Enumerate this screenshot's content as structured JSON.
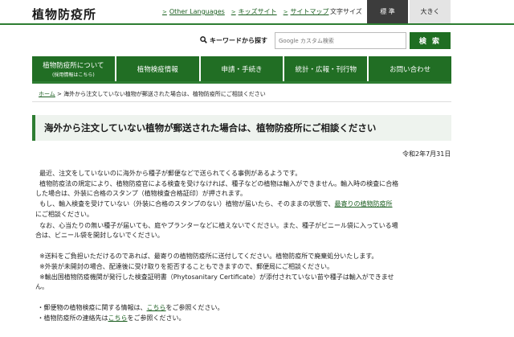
{
  "header": {
    "site_title": "植物防疫所",
    "links": [
      "Other Languages",
      "キッズサイト",
      "サイトマップ"
    ],
    "font_size_label": "文字サイズ",
    "font_standard": "標 準",
    "font_large": "大きく"
  },
  "search": {
    "label": "キーワードから探す",
    "placeholder": "Google カスタム検索",
    "button": "検 索"
  },
  "nav": {
    "items": [
      {
        "label": "植物防疫所について",
        "sub": "(採用情報はこちら)"
      },
      {
        "label": "植物検疫情報",
        "sub": ""
      },
      {
        "label": "申請・手続き",
        "sub": ""
      },
      {
        "label": "統計・広報・刊行物",
        "sub": ""
      },
      {
        "label": "お問い合わせ",
        "sub": ""
      }
    ]
  },
  "breadcrumb": {
    "home": "ホーム",
    "separator": ">",
    "current": "海外から注文していない植物が郵送された場合は、植物防疫所にご相談ください"
  },
  "main": {
    "title": "海外から注文していない植物が郵送された場合は、植物防疫所にご相談ください",
    "date": "令和2年7月31日",
    "p1": "最近、注文をしていないのに海外から種子が郵便などで送られてくる事例があるようです。",
    "p2a": "植物防疫法の規定により、植物防疫官による検査を受けなければ、種子などの植物は輸入ができません。輸入時の検査に合格",
    "p2b": "した場合は、外装に合格のスタンプ（植物検査合格証印）が押されます。",
    "p3a_pre": "もし、輸入検査を受けていない（外装に合格のスタンプのない）植物が届いたら、そのままの状態で、",
    "p3a_link": "最寄りの植物防疫所",
    "p3b": "にご相談ください。",
    "p4a": "なお、心当たりの無い種子が届いても、庭やプランターなどに植えないでください。また、種子がビニール袋に入っている場",
    "p4b": "合は、ビニール袋を開封しないでください。",
    "n1": "※送料をご負担いただけるのであれば、最寄りの植物防疫所に送付してください。植物防疫所で廃棄処分いたします。",
    "n2": "※外装が未開封の場合、配達後に受け取りを拒否することもできますので、郵便局にご相談ください。",
    "n3a": "※輸出国植物防疫機関が発行した検査証明書（Phytosanitary Certificate）が添付されていない苗や種子は輸入ができませ",
    "n3b": "ん。",
    "b1_pre": "・郵便物の植物検疫に関する情報は、",
    "b1_link": "こちら",
    "b1_post": "をご参照ください。",
    "b2_pre": "・植物防疫所の連絡先は",
    "b2_link": "こちら",
    "b2_post": "をご参照ください。"
  },
  "colors": {
    "brand_green": "#2e7d32",
    "nav_green": "#216e24",
    "title_bg": "#eef3ee"
  }
}
